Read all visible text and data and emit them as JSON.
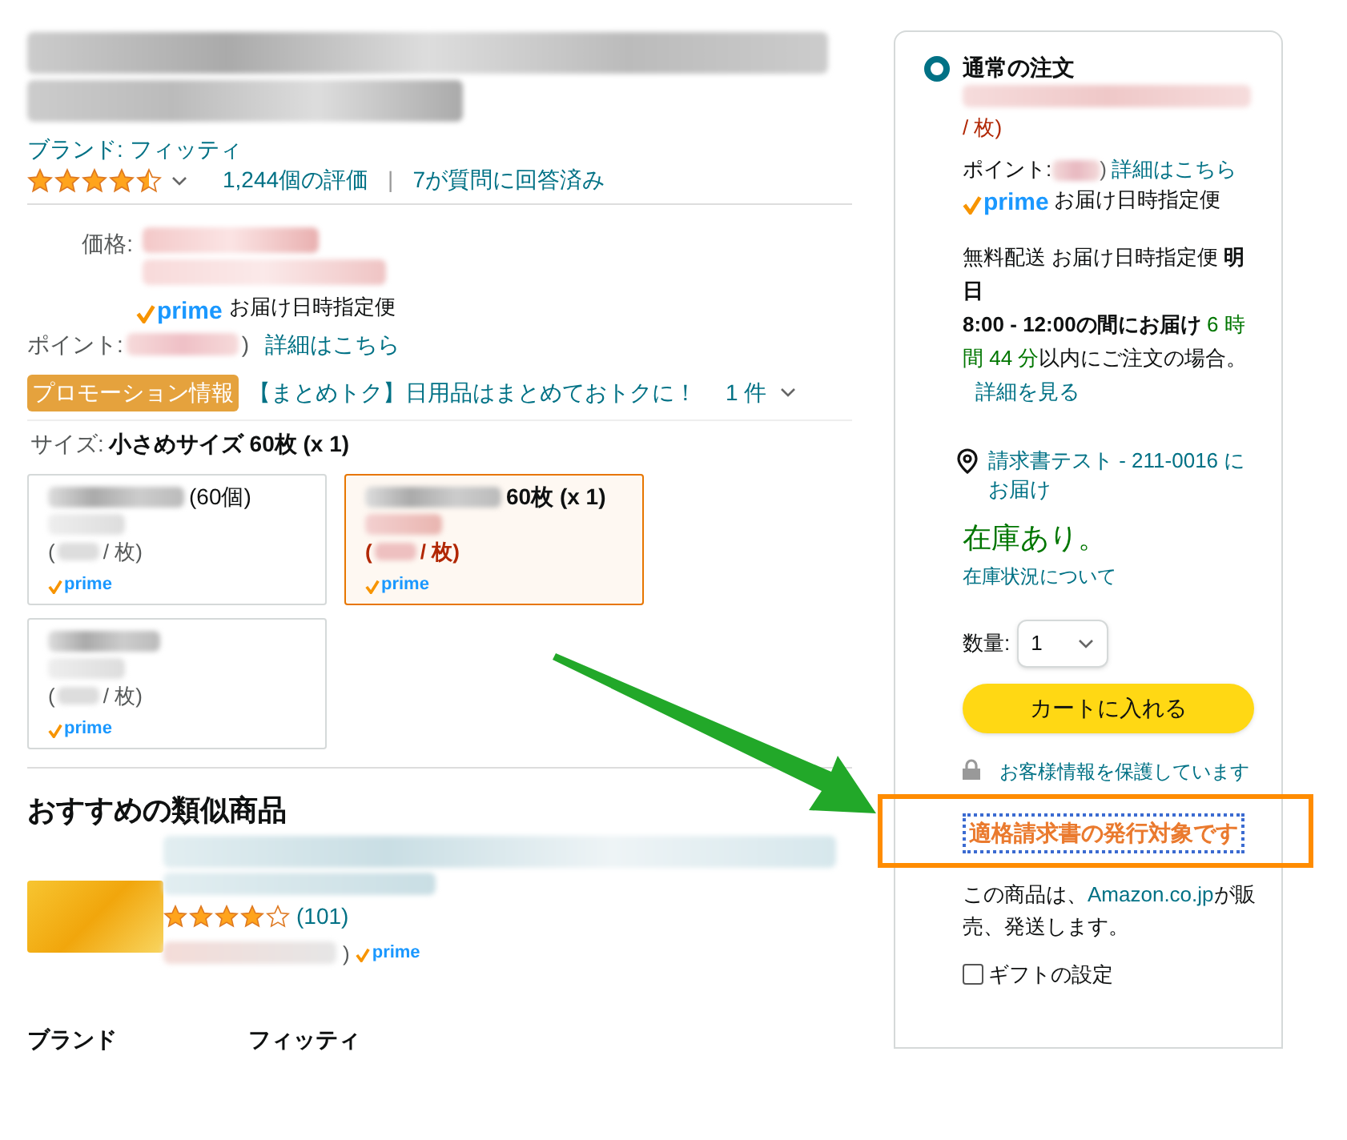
{
  "product": {
    "brand": "ブランド: フィッティ",
    "stars": 4.5,
    "ratings_link": "1,244個の評価",
    "separator": "|",
    "answers_link": "7が質問に回答済み"
  },
  "price": {
    "label": "価格:",
    "prime": "prime",
    "delivery": "お届け日時指定便"
  },
  "points": {
    "label": "ポイント:",
    "close_paren": ")",
    "link": "詳細はこちら"
  },
  "promotion": {
    "badge": "プロモーション情報",
    "text": "【まとめトク】日用品はまとめておトクに！",
    "count": "1 件"
  },
  "size": {
    "label": "サイズ:",
    "value": "小さめサイズ 60枚 (x 1)"
  },
  "variants": [
    {
      "title_suffix": "(60個)",
      "open": "(",
      "unit": "/ 枚)",
      "prime": "prime",
      "selected": false
    },
    {
      "title_suffix": "60枚 (x 1)",
      "open": "(",
      "unit": "/ 枚)",
      "prime": "prime",
      "selected": true
    },
    {
      "open": "(",
      "unit": "/ 枚)",
      "prime": "prime",
      "selected": false
    }
  ],
  "similar": {
    "heading": "おすすめの類似商品",
    "items": [
      {
        "stars": 4,
        "count": "(101)",
        "close_paren": ")",
        "prime": "prime"
      }
    ]
  },
  "specs": [
    {
      "label": "ブランド",
      "value": "フィッティ"
    }
  ],
  "buy_box": {
    "option": {
      "label": "通常の注文",
      "selected": true
    },
    "unit": "/ 枚)",
    "points_label": "ポイント:",
    "points_paren": ")",
    "points_link": "詳細はこちら",
    "prime": "prime",
    "prime_delivery": "お届け日時指定便",
    "delivery": "無料配送 お届け日時指定便 **明日**",
    "delivery_time": "8:00 - 12:00の間にお届け",
    "countdown": "6 時間 44 分",
    "countdown_rest": "以内にご注文の場合。",
    "details_link": "詳細を見る",
    "address": "請求書テスト - 211-0016 にお届け",
    "stock": "在庫あり。",
    "stock_link": "在庫状況について",
    "quantity": {
      "label": "数量:",
      "value": "1"
    },
    "cart_button": "カートに入れる",
    "secure_link": "お客様情報を保護しています",
    "invoice": "適格請求書の発行対象です",
    "seller_prefix": "この商品は、",
    "seller_link": "Amazon.co.jp",
    "seller_suffix": "が販売、発送します。",
    "gift": {
      "label": "ギフトの設定",
      "checked": false
    }
  }
}
